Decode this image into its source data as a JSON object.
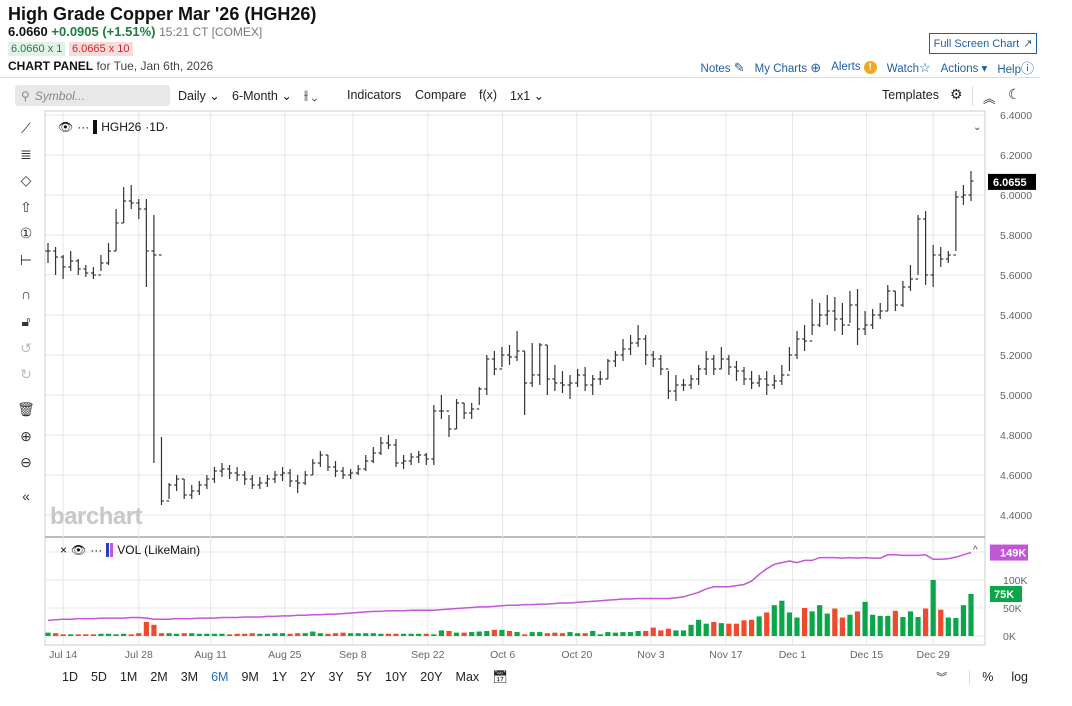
{
  "header": {
    "title": "High Grade Copper Mar '26 (HGH26)",
    "last": "6.0660",
    "change": "+0.0905 (+1.51%)",
    "time": "15:21 CT [COMEX]",
    "bid": "6.0660 x 1",
    "ask": "6.0665 x 10",
    "panel_label": "CHART PANEL",
    "panel_date": "for Tue, Jan 6th, 2026",
    "full_screen": "Full Screen Chart"
  },
  "links": {
    "notes": "Notes",
    "my_charts": "My Charts",
    "alerts": "Alerts",
    "watch": "Watch",
    "actions": "Actions",
    "help": "Help"
  },
  "toolbar": {
    "symbol_placeholder": "Symbol...",
    "interval": "Daily",
    "period": "6-Month",
    "indicators": "Indicators",
    "compare": "Compare",
    "fx": "f(x)",
    "layout": "1x1",
    "templates": "Templates"
  },
  "legend": {
    "symbol": "HGH26",
    "interval": "·1D·",
    "volume": "VOL (LikeMain)"
  },
  "watermark": "barchart",
  "bottom": {
    "ranges": [
      "1D",
      "5D",
      "1M",
      "2M",
      "3M",
      "6M",
      "9M",
      "1Y",
      "2Y",
      "3Y",
      "5Y",
      "10Y",
      "20Y",
      "Max"
    ],
    "selected": "6M",
    "pct": "%",
    "log": "log"
  },
  "colors": {
    "up": "#0aa64a",
    "down": "#f04a2c",
    "oi": "#c356d6",
    "accent": "#1f5fa6",
    "bar": "#333333"
  },
  "chart_data": {
    "type": "ohlc-bar",
    "price_axis": {
      "min": 4.4,
      "max": 6.4,
      "ticks": [
        "6.4000",
        "6.2000",
        "6.0000",
        "5.8000",
        "5.6000",
        "5.4000",
        "5.2000",
        "5.0000",
        "4.8000",
        "4.6000",
        "4.4000"
      ]
    },
    "last_price_label": "6.0655",
    "x_ticks": [
      {
        "label": "Jul 14",
        "bar": 2
      },
      {
        "label": "Jul 28",
        "bar": 12
      },
      {
        "label": "Aug 11",
        "bar": 21.5
      },
      {
        "label": "Aug 25",
        "bar": 31.3
      },
      {
        "label": "Sep 8",
        "bar": 40.3
      },
      {
        "label": "Sep 22",
        "bar": 50.2
      },
      {
        "label": "Oct 6",
        "bar": 60.1
      },
      {
        "label": "Oct 20",
        "bar": 69.9
      },
      {
        "label": "Nov 3",
        "bar": 79.7
      },
      {
        "label": "Nov 17",
        "bar": 89.6
      },
      {
        "label": "Dec 1",
        "bar": 98.4
      },
      {
        "label": "Dec 15",
        "bar": 108.2
      },
      {
        "label": "Dec 29",
        "bar": 117
      }
    ],
    "bars_hlc": [
      [
        5.76,
        5.66,
        5.72
      ],
      [
        5.74,
        5.6,
        5.69
      ],
      [
        5.7,
        5.58,
        5.64
      ],
      [
        5.72,
        5.62,
        5.67
      ],
      [
        5.68,
        5.6,
        5.63
      ],
      [
        5.65,
        5.59,
        5.61
      ],
      [
        5.64,
        5.58,
        5.6
      ],
      [
        5.7,
        5.62,
        5.66
      ],
      [
        5.76,
        5.65,
        5.72
      ],
      [
        5.93,
        5.72,
        5.86
      ],
      [
        6.04,
        5.86,
        5.97
      ],
      [
        6.05,
        5.93,
        5.96
      ],
      [
        5.98,
        5.88,
        5.93
      ],
      [
        5.98,
        5.54,
        5.72
      ],
      [
        5.9,
        4.66,
        5.7
      ],
      [
        4.79,
        4.45,
        4.47
      ],
      [
        4.56,
        4.48,
        4.55
      ],
      [
        4.6,
        4.52,
        4.58
      ],
      [
        4.58,
        4.48,
        4.5
      ],
      [
        4.55,
        4.48,
        4.52
      ],
      [
        4.57,
        4.5,
        4.55
      ],
      [
        4.6,
        4.53,
        4.58
      ],
      [
        4.64,
        4.56,
        4.62
      ],
      [
        4.66,
        4.59,
        4.63
      ],
      [
        4.65,
        4.58,
        4.61
      ],
      [
        4.64,
        4.57,
        4.6
      ],
      [
        4.62,
        4.55,
        4.58
      ],
      [
        4.6,
        4.53,
        4.55
      ],
      [
        4.59,
        4.53,
        4.56
      ],
      [
        4.6,
        4.54,
        4.58
      ],
      [
        4.62,
        4.56,
        4.6
      ],
      [
        4.64,
        4.57,
        4.61
      ],
      [
        4.63,
        4.54,
        4.57
      ],
      [
        4.6,
        4.51,
        4.56
      ],
      [
        4.62,
        4.55,
        4.6
      ],
      [
        4.68,
        4.6,
        4.66
      ],
      [
        4.72,
        4.64,
        4.7
      ],
      [
        4.7,
        4.62,
        4.64
      ],
      [
        4.67,
        4.59,
        4.62
      ],
      [
        4.64,
        4.58,
        4.6
      ],
      [
        4.63,
        4.58,
        4.61
      ],
      [
        4.65,
        4.6,
        4.63
      ],
      [
        4.7,
        4.62,
        4.67
      ],
      [
        4.74,
        4.66,
        4.71
      ],
      [
        4.79,
        4.7,
        4.76
      ],
      [
        4.8,
        4.73,
        4.75
      ],
      [
        4.78,
        4.64,
        4.66
      ],
      [
        4.7,
        4.63,
        4.67
      ],
      [
        4.71,
        4.65,
        4.69
      ],
      [
        4.72,
        4.66,
        4.7
      ],
      [
        4.71,
        4.65,
        4.68
      ],
      [
        4.95,
        4.65,
        4.92
      ],
      [
        5.0,
        4.88,
        4.92
      ],
      [
        4.9,
        4.79,
        4.83
      ],
      [
        4.98,
        4.83,
        4.96
      ],
      [
        4.96,
        4.88,
        4.91
      ],
      [
        4.96,
        4.88,
        4.93
      ],
      [
        5.04,
        4.95,
        5.03
      ],
      [
        5.2,
        5.0,
        5.18
      ],
      [
        5.22,
        5.1,
        5.13
      ],
      [
        5.24,
        5.14,
        5.2
      ],
      [
        5.25,
        5.15,
        5.19
      ],
      [
        5.32,
        5.17,
        5.22
      ],
      [
        5.22,
        4.9,
        5.06
      ],
      [
        5.26,
        5.04,
        5.1
      ],
      [
        5.26,
        5.05,
        5.25
      ],
      [
        5.25,
        5.0,
        5.08
      ],
      [
        5.15,
        5.02,
        5.06
      ],
      [
        5.12,
        5.01,
        5.05
      ],
      [
        5.1,
        4.98,
        5.06
      ],
      [
        5.13,
        5.04,
        5.1
      ],
      [
        5.14,
        5.02,
        5.05
      ],
      [
        5.1,
        5.0,
        5.08
      ],
      [
        5.12,
        5.05,
        5.08
      ],
      [
        5.18,
        5.08,
        5.17
      ],
      [
        5.22,
        5.14,
        5.2
      ],
      [
        5.28,
        5.17,
        5.23
      ],
      [
        5.3,
        5.2,
        5.26
      ],
      [
        5.35,
        5.24,
        5.28
      ],
      [
        5.3,
        5.15,
        5.2
      ],
      [
        5.22,
        5.14,
        5.18
      ],
      [
        5.2,
        5.1,
        5.13
      ],
      [
        5.12,
        4.98,
        5.02
      ],
      [
        5.1,
        4.97,
        5.05
      ],
      [
        5.08,
        5.02,
        5.05
      ],
      [
        5.1,
        5.03,
        5.08
      ],
      [
        5.15,
        5.05,
        5.13
      ],
      [
        5.22,
        5.1,
        5.18
      ],
      [
        5.2,
        5.1,
        5.13
      ],
      [
        5.24,
        5.13,
        5.18
      ],
      [
        5.2,
        5.1,
        5.14
      ],
      [
        5.17,
        5.07,
        5.12
      ],
      [
        5.14,
        5.05,
        5.08
      ],
      [
        5.12,
        5.03,
        5.06
      ],
      [
        5.1,
        5.04,
        5.08
      ],
      [
        5.12,
        5.0,
        5.05
      ],
      [
        5.1,
        5.03,
        5.07
      ],
      [
        5.15,
        5.05,
        5.1
      ],
      [
        5.24,
        5.12,
        5.2
      ],
      [
        5.32,
        5.18,
        5.28
      ],
      [
        5.35,
        5.22,
        5.27
      ],
      [
        5.48,
        5.3,
        5.35
      ],
      [
        5.46,
        5.34,
        5.4
      ],
      [
        5.5,
        5.35,
        5.42
      ],
      [
        5.49,
        5.32,
        5.38
      ],
      [
        5.46,
        5.3,
        5.35
      ],
      [
        5.52,
        5.36,
        5.45
      ],
      [
        5.53,
        5.25,
        5.33
      ],
      [
        5.42,
        5.3,
        5.35
      ],
      [
        5.43,
        5.33,
        5.4
      ],
      [
        5.46,
        5.38,
        5.42
      ],
      [
        5.55,
        5.42,
        5.52
      ],
      [
        5.52,
        5.42,
        5.45
      ],
      [
        5.57,
        5.44,
        5.54
      ],
      [
        5.65,
        5.52,
        5.58
      ],
      [
        5.9,
        5.6,
        5.88
      ],
      [
        5.92,
        5.55,
        5.6
      ],
      [
        5.75,
        5.54,
        5.7
      ],
      [
        5.74,
        5.64,
        5.68
      ],
      [
        5.72,
        5.66,
        5.7
      ],
      [
        6.02,
        5.72,
        5.99
      ],
      [
        6.05,
        5.95,
        6.0
      ],
      [
        6.12,
        5.97,
        6.07
      ]
    ],
    "volume_axis": {
      "ticks": [
        {
          "label": "100K",
          "value": 100
        },
        {
          "label": "50K",
          "value": 50
        },
        {
          "label": "0K",
          "value": 0
        }
      ]
    },
    "volume_k": [
      6,
      5,
      3,
      3,
      3,
      3,
      3,
      4,
      4,
      3,
      4,
      3,
      5,
      25,
      20,
      5,
      5,
      4,
      5,
      5,
      4,
      4,
      4,
      4,
      3,
      4,
      4,
      5,
      4,
      4,
      5,
      5,
      4,
      5,
      5,
      8,
      5,
      4,
      5,
      6,
      5,
      5,
      5,
      5,
      4,
      4,
      4,
      4,
      4,
      4,
      4,
      3,
      10,
      9,
      6,
      6,
      7,
      8,
      9,
      11,
      11,
      9,
      7,
      3,
      7,
      7,
      5,
      6,
      5,
      7,
      5,
      5,
      9,
      3,
      7,
      6,
      7,
      7,
      9,
      9,
      15,
      10,
      13,
      10,
      10,
      20,
      29,
      22,
      25,
      23,
      22,
      22,
      28,
      29,
      35,
      42,
      55,
      63,
      42,
      33,
      50,
      44,
      55,
      40,
      49,
      33,
      38,
      44,
      61,
      38,
      36,
      36,
      45,
      34,
      44,
      34,
      49,
      100,
      47,
      33,
      32,
      55,
      75
    ],
    "open_interest_k": [
      28,
      29,
      30,
      30,
      31,
      31,
      31,
      32,
      32,
      32,
      32,
      33,
      33,
      32,
      30,
      30,
      30,
      31,
      31,
      31,
      32,
      32,
      32,
      33,
      33,
      33,
      34,
      34,
      34,
      35,
      35,
      36,
      36,
      37,
      37,
      38,
      38,
      39,
      39,
      40,
      41,
      42,
      43,
      44,
      44,
      45,
      45,
      45,
      46,
      46,
      46,
      46,
      47,
      48,
      49,
      50,
      51,
      52,
      52,
      53,
      54,
      55,
      55,
      56,
      56,
      57,
      57,
      58,
      59,
      59,
      60,
      61,
      62,
      63,
      64,
      65,
      66,
      66,
      67,
      67,
      67,
      67,
      67,
      68,
      70,
      74,
      78,
      84,
      88,
      88,
      88,
      90,
      92,
      98,
      110,
      120,
      128,
      131,
      134,
      131,
      135,
      135,
      140,
      140,
      140,
      139,
      140,
      139,
      140,
      139,
      139,
      145,
      145,
      144,
      144,
      144,
      145,
      137,
      137,
      138,
      141,
      145,
      149
    ],
    "oi_label": "149K",
    "volume_label": "75K"
  }
}
